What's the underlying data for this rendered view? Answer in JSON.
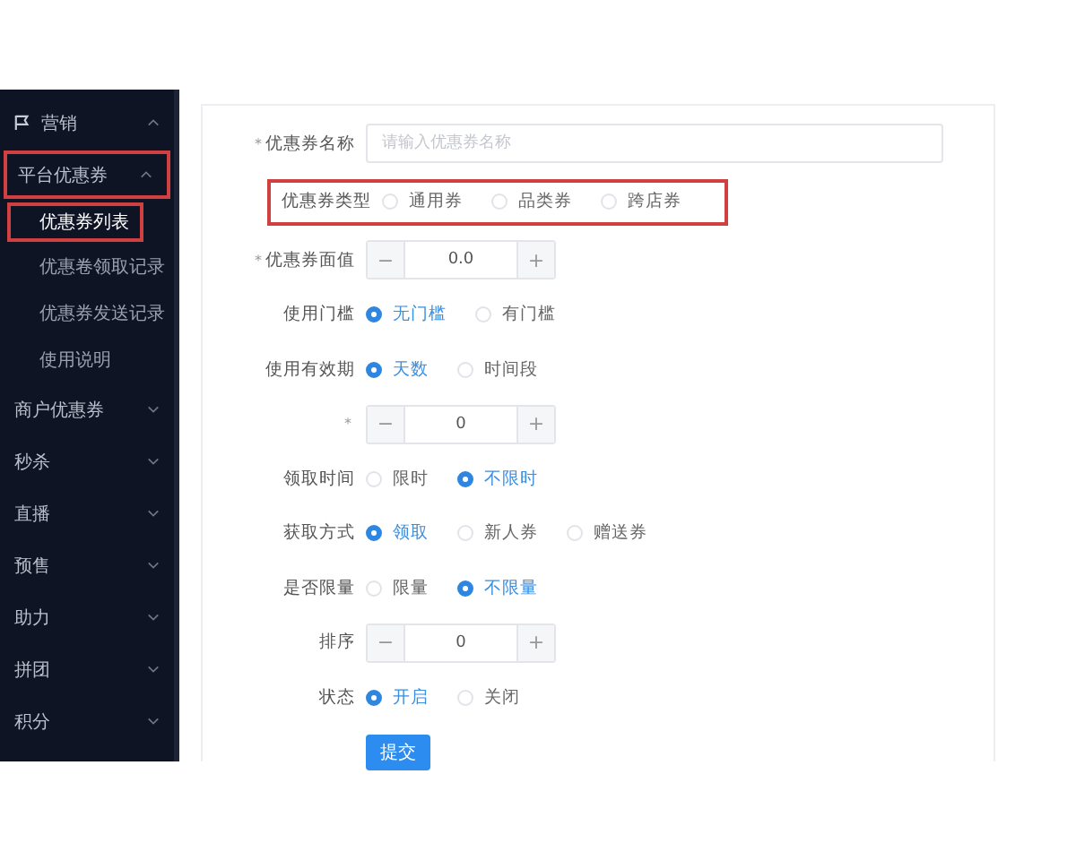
{
  "sidebar": {
    "items": [
      {
        "label": "营销",
        "expanded": true,
        "highlighted": false,
        "children": [
          {
            "label": "平台优惠券",
            "expanded": true,
            "highlighted": true,
            "children": [
              {
                "label": "优惠券列表",
                "selected": true,
                "highlighted": true
              },
              {
                "label": "优惠卷领取记录",
                "selected": false,
                "highlighted": false
              },
              {
                "label": "优惠券发送记录",
                "selected": false,
                "highlighted": false
              },
              {
                "label": "使用说明",
                "selected": false,
                "highlighted": false
              }
            ]
          }
        ]
      },
      {
        "label": "商户优惠券",
        "expanded": false,
        "highlighted": false
      },
      {
        "label": "秒杀",
        "expanded": false,
        "highlighted": false
      },
      {
        "label": "直播",
        "expanded": false,
        "highlighted": false
      },
      {
        "label": "预售",
        "expanded": false,
        "highlighted": false
      },
      {
        "label": "助力",
        "expanded": false,
        "highlighted": false
      },
      {
        "label": "拼团",
        "expanded": false,
        "highlighted": false
      },
      {
        "label": "积分",
        "expanded": false,
        "highlighted": false
      }
    ]
  },
  "form": {
    "rows": [
      {
        "kind": "text",
        "label": "优惠券名称",
        "mark": "*",
        "highlighted": false,
        "placeholder": "请输入优惠券名称"
      },
      {
        "kind": "radio",
        "label": "优惠券类型",
        "highlighted": true,
        "options": [
          {
            "label": "通用券",
            "selected": false
          },
          {
            "label": "品类券",
            "selected": false
          },
          {
            "label": "跨店券",
            "selected": false
          }
        ]
      },
      {
        "kind": "number",
        "label": "优惠券面值",
        "mark": "*",
        "highlighted": false,
        "value": "0.0",
        "minus": "−",
        "plus": "+"
      },
      {
        "kind": "radio",
        "label": "使用门槛",
        "highlighted": false,
        "options": [
          {
            "label": "无门槛",
            "selected": true
          },
          {
            "label": "有门槛",
            "selected": false
          }
        ]
      },
      {
        "kind": "radio",
        "label": "使用有效期",
        "highlighted": false,
        "options": [
          {
            "label": "天数",
            "selected": true
          },
          {
            "label": "时间段",
            "selected": false
          }
        ]
      },
      {
        "kind": "number",
        "mark": "*",
        "highlighted": false,
        "value": "0",
        "minus": "−",
        "plus": "+"
      },
      {
        "kind": "radio",
        "label": "领取时间",
        "highlighted": false,
        "options": [
          {
            "label": "限时",
            "selected": false
          },
          {
            "label": "不限时",
            "selected": true
          }
        ]
      },
      {
        "kind": "radio",
        "label": "获取方式",
        "highlighted": false,
        "options": [
          {
            "label": "领取",
            "selected": true
          },
          {
            "label": "新人券",
            "selected": false
          },
          {
            "label": "赠送券",
            "selected": false
          }
        ]
      },
      {
        "kind": "radio",
        "label": "是否限量",
        "highlighted": false,
        "options": [
          {
            "label": "限量",
            "selected": false
          },
          {
            "label": "不限量",
            "selected": true
          }
        ]
      },
      {
        "kind": "number",
        "label": "排序",
        "highlighted": false,
        "value": "0",
        "minus": "−",
        "plus": "+"
      },
      {
        "kind": "radio",
        "label": "状态",
        "highlighted": false,
        "options": [
          {
            "label": "开启",
            "selected": true
          },
          {
            "label": "关闭",
            "selected": false
          }
        ]
      }
    ],
    "submit": "提交"
  }
}
